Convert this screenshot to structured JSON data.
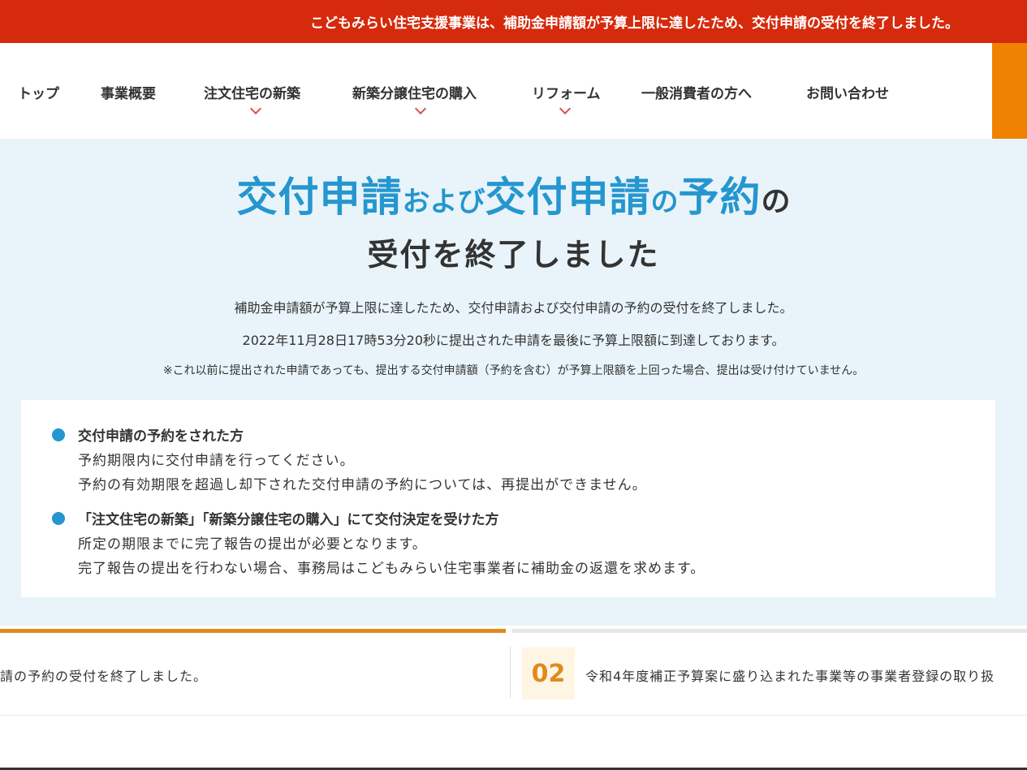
{
  "alert": {
    "text": "こどもみらい住宅支援事業は、補助金申請額が予算上限に達したため、交付申請の受付を終了しました。"
  },
  "nav": {
    "items": [
      {
        "label": "トップ"
      },
      {
        "label": "事業概要"
      },
      {
        "label": "注文住宅の新築",
        "dropdown": true
      },
      {
        "label": "新築分譲住宅の購入",
        "dropdown": true
      },
      {
        "label": "リフォーム",
        "dropdown": true
      },
      {
        "label": "一般消費者の方へ"
      },
      {
        "label": "お問い合わせ"
      }
    ]
  },
  "hero": {
    "title": {
      "part1": "交付申請",
      "part2": "および",
      "part3": "交付申請",
      "part4": "の",
      "part5": "予約",
      "part6": "の"
    },
    "subtitle": "受付を終了しました",
    "desc1": "補助金申請額が予算上限に達したため、交付申請および交付申請の予約の受付を終了しました。",
    "desc2": "2022年11月28日17時53分20秒に提出された申請を最後に予算上限額に到達しております。",
    "note": "※これ以前に提出された申請であっても、提出する交付申請額（予約を含む）が予算上限額を上回った場合、提出は受け付けていません。"
  },
  "info": {
    "items": [
      {
        "heading": "交付申請の予約をされた方",
        "lines": [
          "予約期限内に交付申請を行ってください。",
          "予約の有効期限を超過し却下された交付申請の予約については、再提出ができません。"
        ]
      },
      {
        "heading": "「注文住宅の新築」「新築分譲住宅の購入」にて交付決定を受けた方",
        "lines": [
          "所定の期限までに完了報告の提出が必要となります。",
          "完了報告の提出を行わない場合、事務局はこどもみらい住宅事業者に補助金の返還を求めます。"
        ]
      }
    ]
  },
  "ticker": {
    "item1_text": "請の予約の受付を終了しました。",
    "item2_number": "02",
    "item2_text": "令和4年度補正予算案に盛り込まれた事業等の事業者登録の取り扱"
  },
  "colors": {
    "alert_red": "#d52a0c",
    "accent_blue": "#2596cf",
    "accent_orange": "#e08a1e",
    "hero_bg": "#e8f4f9"
  }
}
